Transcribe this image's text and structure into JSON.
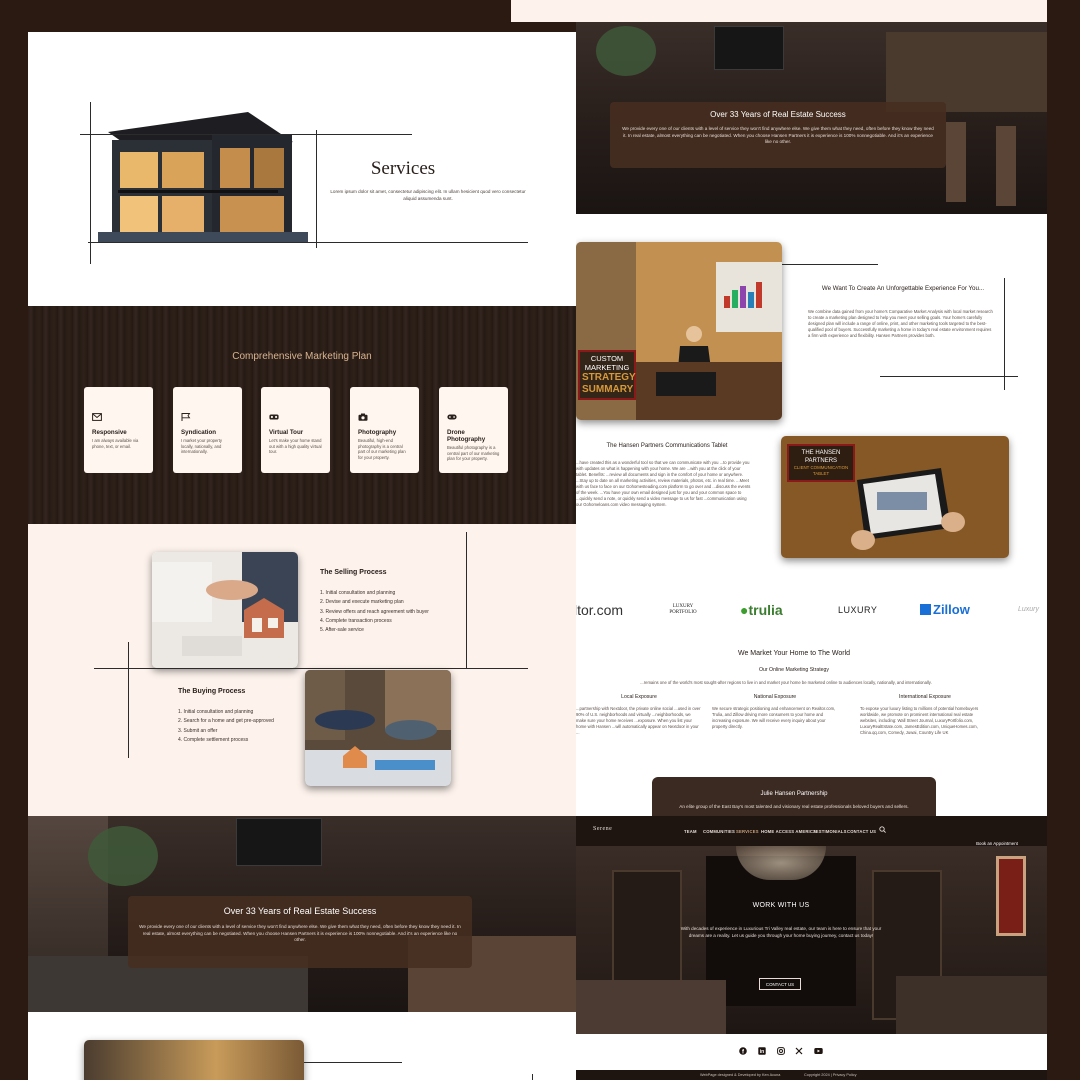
{
  "services": {
    "title": "Services",
    "subtitle": "Lorem ipsum dolor sit amet, consectetur adipiscing elit. In ullam hesicient quod vero consectetur aliquid assumenda sunt."
  },
  "marketing_plan": {
    "title": "Comprehensive Marketing Plan",
    "cards": [
      {
        "icon": "envelope-icon",
        "title": "Responsive",
        "text": "I am always available via phone, text, or email."
      },
      {
        "icon": "flag-icon",
        "title": "Syndication",
        "text": "I market your property locally, nationally, and internationally."
      },
      {
        "icon": "vr-headset-icon",
        "title": "Virtual Tour",
        "text": "Let's make your home stand out with a high quality virtual tour."
      },
      {
        "icon": "camera-icon",
        "title": "Photography",
        "text": "Beautiful, high-end photography is a central part of our marketing plan for your property."
      },
      {
        "icon": "drone-icon",
        "title": "Drone Photography",
        "text": "Beautiful photography is a central part of our marketing plan for your property."
      }
    ]
  },
  "selling": {
    "title": "The Selling Process",
    "steps": [
      "1. Initial consultation and planning",
      "2. Devise and execute marketing plan",
      "3. Review offers and reach agreement with buyer",
      "4. Complete transaction process",
      "5. After-sale service"
    ]
  },
  "buying": {
    "title": "The Buying Process",
    "steps": [
      "1. Initial consultation and planning",
      "2. Search for a home and get pre-approved",
      "3. Submit an offer",
      "4. Complete settlement process"
    ]
  },
  "success": {
    "title": "Over 33 Years of Real Estate Success",
    "text": "We provide every one of our clients with a level of service they won't find anywhere else. We give them what they need, often before they know they need it. In real estate, almost everything can be negotiated. When you choose Hansen Partners it is experience is 100% nonnegotiable. And it's an experience like no other."
  },
  "experience": {
    "title": "We Want To Create An Unforgettable Experience For You...",
    "text": "We combine data gained from your home's Comparative Market Analysis with local market research to create a marketing plan designed to help you meet your selling goals. Your home's carefully designed plan will include a range of online, print, and other marketing tools targeted to the best-qualified pool of buyers. Successfully marketing a home in today's real estate environment requires a firm with experience and flexibility. Hansen Partners provides both.",
    "image_caption": [
      "CUSTOM",
      "MARKETING",
      "STRATEGY",
      "SUMMARY"
    ]
  },
  "tablet": {
    "title": "The Hansen Partners Communications Tablet",
    "text": "...have created this as a wonderful tool so that we can communicate with you ...to provide you with updates on what is happening with your home. We are ...with you at the click of your tablet. Benefits: ...review all documents and sign in the comfort of your home or anywhere. ...Stay up to date on all marketing activities, review materials, photos, etc. in real time. ...Meet with us face to face on our Gohomesteading.com platform to go over and ...discuss the events of the week. ...You have your own email designed just for you and your common space to ...quickly send a note, or quickly send a video message to us for fast ...communication using our Gohomeloans.com video messaging system.",
    "image_caption": [
      "THE HANSEN",
      "PARTNERS",
      "CLIENT COMMUNICATION",
      "TABLET"
    ]
  },
  "logos": [
    "ltor.com",
    "LUXURY PORTFOLIO",
    "trulia",
    "LUXURY",
    "Zillow",
    "Luxury"
  ],
  "market": {
    "title": "We Market Your Home to The World",
    "subtitle": "Our Online Marketing Strategy",
    "intro": "...remains one of the world's most sought-after regions to live in and market your home be marketed online to audiences locally, nationally, and internationally.",
    "columns": [
      {
        "title": "Local Exposure",
        "text": "...partnership with Nextdoor, the private online social ...used in over 90% of U.S. neighborhoods and virtually ...neighborhoods, we make sure your home receives ...exposure. When you list your home with Hansen ...will automatically appear on Nextdoor in your ..."
      },
      {
        "title": "National Exposure",
        "text": "We secure strategic positioning and enhancement on Realtor.com, Trulia, and Zillow driving more consumers to your home and increasing exposure. We will receive every inquiry about your property directly."
      },
      {
        "title": "International Exposure",
        "text": "To expose your luxury listing to millions of potential homebuyers worldwide, we promote on prominent international real estate websites, including: Wall Street Journal, LuxuryPortfolio.com, LuxuryRealEstate.com, JamesEdition.com, UniqueHomes.com, China.qq.com, Comedy, Juwai, Country Life UK"
      }
    ]
  },
  "partnership": {
    "title": "Julie Hansen Partnership",
    "text": "An elite group of the East Bay's most talented and visionary real estate professionals beloved buyers and sellers."
  },
  "nav": {
    "logo": "Serene",
    "items": [
      "TEAM",
      "COMMUNITIES",
      "SERVICES",
      "HOME ACCESS AMERICA",
      "TESTIMONIALS",
      "CONTACT US"
    ],
    "active": "SERVICES",
    "cta": "Book an Appointment"
  },
  "work": {
    "title": "WORK WITH US",
    "text": "With decades of experience in Luxurious Tri Valley real estate, our team is here to ensure that your dreams are a reality. Let us guide you through your home buying journey, contact us today!",
    "button": "CONTACT US"
  },
  "social": [
    "facebook-icon",
    "linkedin-icon",
    "instagram-icon",
    "x-icon",
    "youtube-icon"
  ],
  "footer": {
    "credit": "WebPage designed & Developed by Ken Acuna",
    "copyright": "Copyright 2024 | Privacy Policy"
  },
  "colors": {
    "dark": "#2a1a12",
    "cream": "#fdf2ec",
    "brown_panel": "#3b2a22",
    "accent": "#c9a27f",
    "nav_active": "#c9a27f"
  }
}
